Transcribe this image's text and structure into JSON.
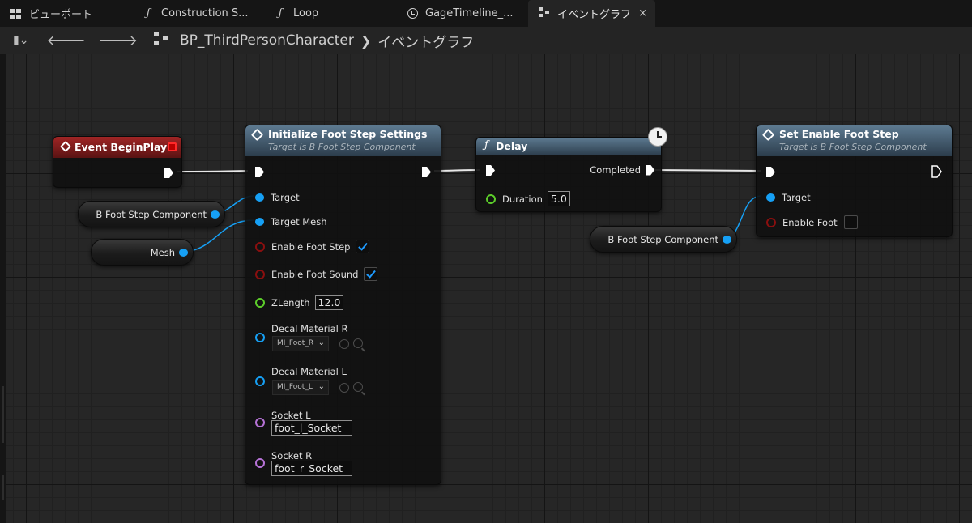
{
  "tabs": [
    {
      "label": "ビューポート",
      "icon": "viewport-grid-icon"
    },
    {
      "label": "Construction S...",
      "icon": "function-icon"
    },
    {
      "label": "Loop",
      "icon": "function-icon"
    },
    {
      "label": "GageTimeline_...",
      "icon": "clock-icon"
    },
    {
      "label": "イベントグラフ",
      "icon": "graph-icon",
      "close": "×"
    }
  ],
  "toolbar": {
    "breadcrumb_root": "BP_ThirdPersonCharacter",
    "breadcrumb_sep": "❯",
    "breadcrumb_current": "イベントグラフ"
  },
  "nodes": {
    "begin_play": {
      "title": "Event BeginPlay"
    },
    "init_foot": {
      "title": "Initialize Foot Step Settings",
      "subtitle": "Target is B Foot Step Component",
      "pins": {
        "target": "Target",
        "target_mesh": "Target Mesh",
        "enable_foot_step": "Enable Foot Step",
        "enable_foot_sound": "Enable Foot Sound",
        "zlength": "ZLength",
        "zlength_value": "12.0",
        "decal_r": "Decal Material R",
        "decal_r_value": "MI_Foot_R",
        "decal_l": "Decal Material L",
        "decal_l_value": "MI_Foot_L",
        "socket_l": "Socket L",
        "socket_l_value": "foot_l_Socket",
        "socket_r": "Socket R",
        "socket_r_value": "foot_r_Socket"
      },
      "enable_foot_step_checked": true,
      "enable_foot_sound_checked": true
    },
    "delay": {
      "title": "Delay",
      "completed": "Completed",
      "duration": "Duration",
      "duration_value": "5.0"
    },
    "set_enable": {
      "title": "Set Enable Foot Step",
      "subtitle": "Target is B Foot Step Component",
      "target": "Target",
      "enable_foot": "Enable Foot",
      "enable_foot_checked": false
    },
    "var_comp_1": {
      "label": "B Foot Step Component"
    },
    "var_mesh": {
      "label": "Mesh"
    },
    "var_comp_2": {
      "label": "B Foot Step Component"
    }
  },
  "colors": {
    "exec": "#ffffff",
    "object_pin": "#16a0f5",
    "bool_pin": "#8a0f0f",
    "float_pin": "#5ccd2a",
    "name_pin": "#b672d6",
    "event_header": "#8a1a1a",
    "function_header": "#4d6a80"
  }
}
